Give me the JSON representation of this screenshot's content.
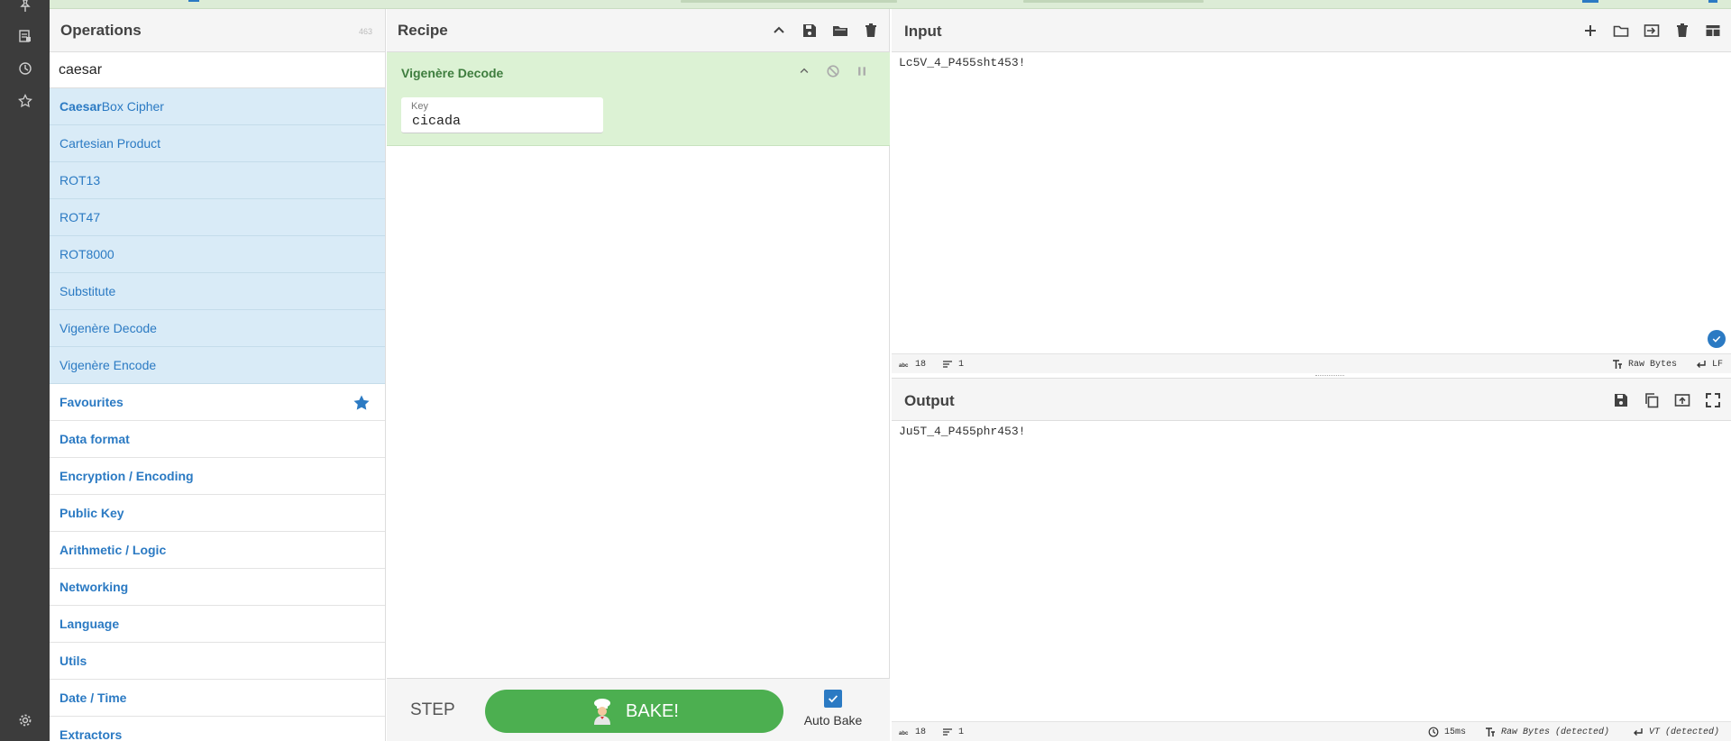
{
  "colors": {
    "accent": "#2b7ac3",
    "recipe_bg": "#dcf2d4",
    "bake": "#4caf50",
    "rail": "#3c3c3c"
  },
  "operations": {
    "title": "Operations",
    "count": "463",
    "search_value": "caesar",
    "results": [
      {
        "bold": "Caesar",
        "rest": " Box Cipher"
      },
      {
        "bold": "",
        "rest": "Cartesian Product"
      },
      {
        "bold": "",
        "rest": "ROT13"
      },
      {
        "bold": "",
        "rest": "ROT47"
      },
      {
        "bold": "",
        "rest": "ROT8000"
      },
      {
        "bold": "",
        "rest": "Substitute"
      },
      {
        "bold": "",
        "rest": "Vigenère Decode"
      },
      {
        "bold": "",
        "rest": "Vigenère Encode"
      }
    ],
    "categories": [
      "Favourites",
      "Data format",
      "Encryption / Encoding",
      "Public Key",
      "Arithmetic / Logic",
      "Networking",
      "Language",
      "Utils",
      "Date / Time",
      "Extractors"
    ]
  },
  "recipe": {
    "title": "Recipe",
    "operation_name": "Vigenère Decode",
    "arg_label": "Key",
    "arg_value": "cicada",
    "step_label": "STEP",
    "bake_label": "BAKE!",
    "auto_bake_label": "Auto Bake",
    "auto_bake_checked": true
  },
  "input": {
    "title": "Input",
    "text": "Lc5V_4_P455sht453!",
    "stats_length": "18",
    "stats_lines": "1",
    "encoding": "Raw Bytes",
    "eol": "LF"
  },
  "output": {
    "title": "Output",
    "text": "Ju5T_4_P455phr453!",
    "stats_length": "18",
    "stats_lines": "1",
    "time": "15ms",
    "encoding": "Raw Bytes (detected)",
    "eol": "VT (detected)"
  },
  "icons": [
    "pin-icon",
    "sidebar-icon",
    "clock-icon",
    "star-icon",
    "settings-icon",
    "chevron-up-icon",
    "save-icon",
    "folder-icon",
    "trash-icon",
    "disable-icon",
    "pause-icon",
    "plus-icon",
    "switch-icon",
    "layout-icon",
    "copy-icon",
    "replace-input-icon",
    "maximize-icon",
    "check-icon"
  ]
}
